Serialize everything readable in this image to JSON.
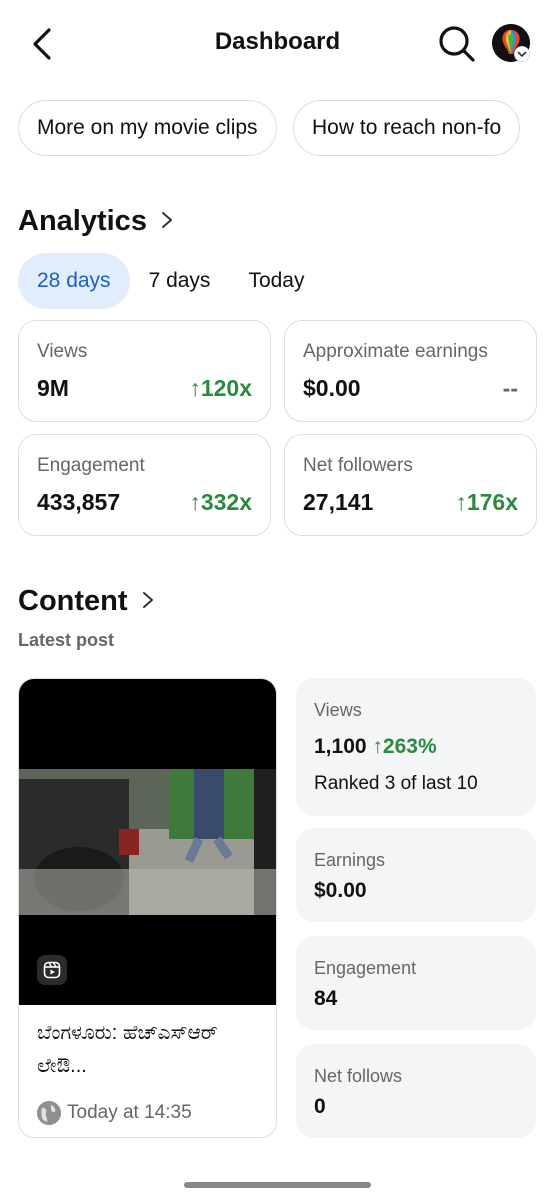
{
  "header": {
    "title": "Dashboard",
    "back_icon": "chevron-left-icon",
    "search_icon": "search-icon"
  },
  "chips": [
    {
      "label": "More on my movie clips"
    },
    {
      "label": "How to reach non-fo"
    }
  ],
  "analytics": {
    "title": "Analytics",
    "tabs": [
      {
        "label": "28 days",
        "active": true
      },
      {
        "label": "7 days",
        "active": false
      },
      {
        "label": "Today",
        "active": false
      }
    ],
    "cards": [
      {
        "label": "Views",
        "value": "9M",
        "change": "↑120x"
      },
      {
        "label": "Approximate earnings",
        "value": "$0.00",
        "change": "--"
      },
      {
        "label": "Engagement",
        "value": "433,857",
        "change": "↑332x"
      },
      {
        "label": "Net followers",
        "value": "27,141",
        "change": "↑176x"
      }
    ]
  },
  "content": {
    "title": "Content",
    "subtitle": "Latest post",
    "post": {
      "caption": "ಬೆಂಗಳೂರು: ಹೆಚ್‌ಎಸ್‌ಆರ್ ಲೇಔ...",
      "time": "Today at 14:35"
    },
    "stats": {
      "views_label": "Views",
      "views_value": "1,100",
      "views_change": "↑263%",
      "rank": "Ranked 3 of last 10",
      "earnings_label": "Earnings",
      "earnings_value": "$0.00",
      "engagement_label": "Engagement",
      "engagement_value": "84",
      "follows_label": "Net follows",
      "follows_value": "0"
    }
  },
  "colors": {
    "accent": "#1a5fc1",
    "accent_bg": "#e2edfb",
    "positive": "#2b8a3e"
  }
}
